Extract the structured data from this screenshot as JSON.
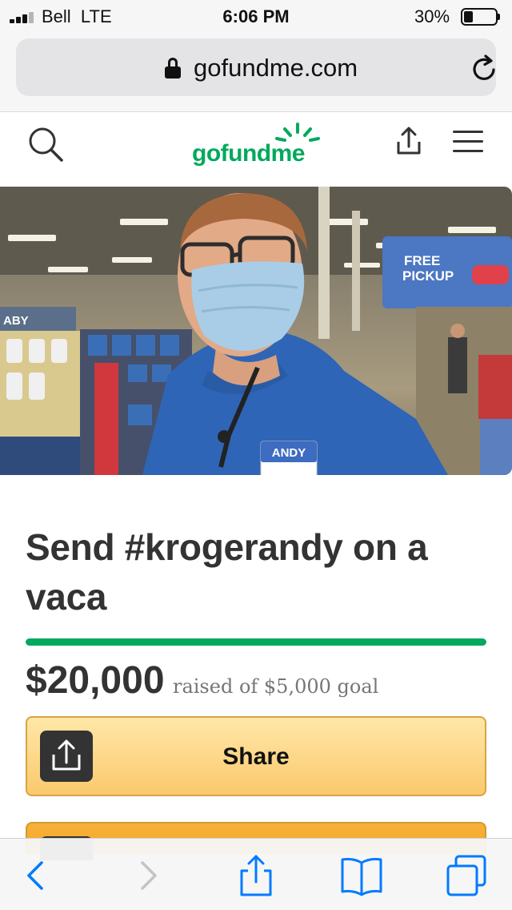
{
  "status_bar": {
    "carrier": "Bell",
    "network": "LTE",
    "time": "6:06 PM",
    "battery_percent_label": "30%",
    "battery_level": 0.3,
    "signal_bars": 3
  },
  "browser": {
    "url": "gofundme.com",
    "icons": {
      "lock": "lock-icon",
      "reload": "reload-icon",
      "back": "back-chevron-icon",
      "forward": "forward-chevron-icon",
      "share": "share-icon",
      "bookmarks": "bookmarks-icon",
      "tabs": "tabs-icon"
    },
    "accent_color": "#007aff"
  },
  "site_header": {
    "logo_text": "gofundme",
    "brand_color": "#02a95c",
    "icons": [
      "search-icon",
      "share-icon",
      "menu-icon"
    ]
  },
  "hero_image": {
    "name_tag_text": "ANDY",
    "sign_line_1": "FREE",
    "sign_line_2": "PICKUP",
    "aisle_sign": "ABY"
  },
  "campaign": {
    "title": "Send #krogerandy on a vaca",
    "raised_amount": "$20,000",
    "raised_suffix": "raised of $5,000 goal",
    "progress_fraction": 1.0,
    "share_label": "Share"
  }
}
